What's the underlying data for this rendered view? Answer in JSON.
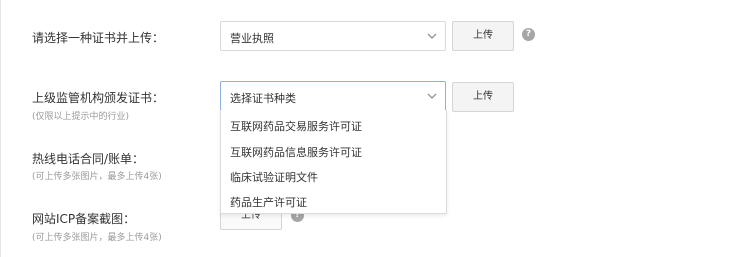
{
  "form": {
    "cert_type": {
      "label": "请选择一种证书并上传：",
      "selected": "营业执照",
      "upload_label": "上传",
      "help": "?"
    },
    "supervisor_cert": {
      "label": "上级监管机构颁发证书：",
      "hint": "(仅限以上提示中的行业)",
      "selected": "选择证书种类",
      "upload_label": "上传",
      "options": [
        "互联网药品交易服务许可证",
        "互联网药品信息服务许可证",
        "临床试验证明文件",
        "药品生产许可证"
      ]
    },
    "hotline": {
      "label": "热线电话合同/账单：",
      "hint": "(可上传多张图片，最多上传4张)"
    },
    "icp": {
      "label": "网站ICP备案截图：",
      "hint": "(可上传多张图片，最多上传4张)",
      "upload_label": "上传",
      "help": "?"
    }
  },
  "colors": {
    "active_border": "#8fb0d9",
    "hint_text": "#9a9a9a",
    "help_icon_bg": "#a6a6a6"
  },
  "icons": {
    "select_arrow": "chevron-down-icon",
    "help": "question-icon"
  }
}
